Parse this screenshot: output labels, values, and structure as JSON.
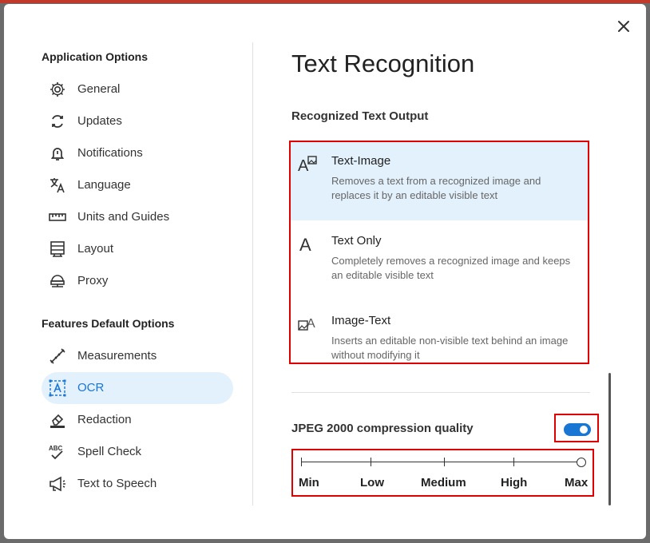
{
  "dialog": {
    "close_icon": "close-icon"
  },
  "sidebar": {
    "application_title": "Application Options",
    "application_items": [
      {
        "label": "General",
        "icon": "gear-icon"
      },
      {
        "label": "Updates",
        "icon": "refresh-icon"
      },
      {
        "label": "Notifications",
        "icon": "bell-icon"
      },
      {
        "label": "Language",
        "icon": "translate-icon"
      },
      {
        "label": "Units and Guides",
        "icon": "ruler-icon"
      },
      {
        "label": "Layout",
        "icon": "layout-icon"
      },
      {
        "label": "Proxy",
        "icon": "proxy-icon"
      }
    ],
    "features_title": "Features Default Options",
    "features_items": [
      {
        "label": "Measurements",
        "icon": "measure-icon"
      },
      {
        "label": "OCR",
        "icon": "ocr-icon",
        "selected": true
      },
      {
        "label": "Redaction",
        "icon": "eraser-icon"
      },
      {
        "label": "Spell Check",
        "icon": "spellcheck-icon"
      },
      {
        "label": "Text to Speech",
        "icon": "megaphone-icon"
      }
    ]
  },
  "main": {
    "title": "Text Recognition",
    "output_title": "Recognized Text Output",
    "options": [
      {
        "title": "Text-Image",
        "desc": "Removes a text from a recognized image and replaces it by an editable visible text",
        "icon": "text-image-icon",
        "selected": true
      },
      {
        "title": "Text Only",
        "desc": "Completely removes a recognized image and keeps an editable visible text",
        "icon": "text-only-icon"
      },
      {
        "title": "Image-Text",
        "desc": "Inserts an editable non-visible text behind an image without modifying it",
        "icon": "image-text-icon"
      }
    ],
    "jpeg_label": "JPEG 2000 compression quality",
    "jpeg_enabled": true,
    "slider": {
      "labels": [
        "Min",
        "Low",
        "Medium",
        "High",
        "Max"
      ],
      "value": "Max"
    }
  },
  "colors": {
    "accent": "#1976d2",
    "selected_bg": "#e3f1fc",
    "highlight": "#e00000"
  }
}
